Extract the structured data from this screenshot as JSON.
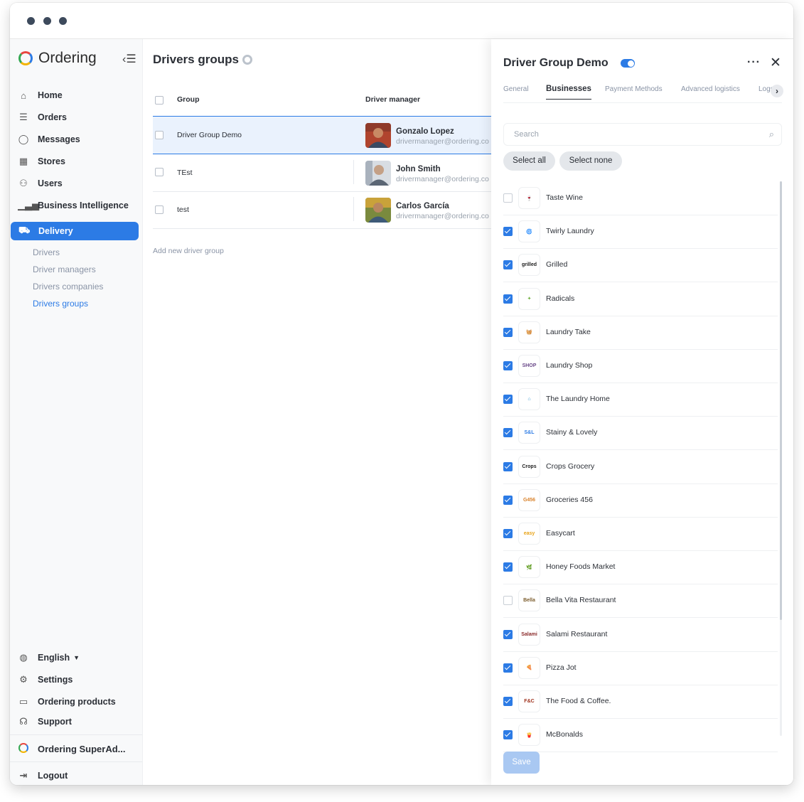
{
  "app": {
    "brand": "Ordering"
  },
  "sidebar": {
    "nav": [
      {
        "label": "Home",
        "icon": "home-icon"
      },
      {
        "label": "Orders",
        "icon": "list-icon"
      },
      {
        "label": "Messages",
        "icon": "chat-icon"
      },
      {
        "label": "Stores",
        "icon": "store-icon"
      },
      {
        "label": "Users",
        "icon": "users-icon"
      },
      {
        "label": "Business Intelligence",
        "icon": "chart-icon"
      },
      {
        "label": "Delivery",
        "icon": "truck-icon"
      }
    ],
    "delivery_sub": [
      "Drivers",
      "Driver managers",
      "Drivers companies",
      "Drivers groups"
    ],
    "bottom": {
      "language": "English",
      "settings": "Settings",
      "ordering_products": "Ordering products",
      "support": "Support",
      "account": "Ordering SuperAd...",
      "logout": "Logout"
    }
  },
  "main": {
    "title": "Drivers groups",
    "columns": {
      "group": "Group",
      "manager": "Driver manager"
    },
    "rows": [
      {
        "group": "Driver Group Demo",
        "manager": "Gonzalo Lopez",
        "email": "drivermanager@ordering.co"
      },
      {
        "group": "TEst",
        "manager": "John Smith",
        "email": "drivermanager@ordering.co"
      },
      {
        "group": "test",
        "manager": "Carlos García",
        "email": "drivermanager@ordering.co"
      }
    ],
    "add_link": "Add new driver group"
  },
  "panel": {
    "title": "Driver Group Demo",
    "tabs": [
      "General",
      "Businesses",
      "Payment Methods",
      "Advanced logistics",
      "Logs"
    ],
    "active_tab": "Businesses",
    "search_placeholder": "Search",
    "select_all": "Select all",
    "select_none": "Select none",
    "save": "Save",
    "businesses": [
      {
        "name": "Taste Wine",
        "checked": false,
        "logo": "🍷"
      },
      {
        "name": "Twirly Laundry",
        "checked": true,
        "logo": "🌀"
      },
      {
        "name": "Grilled",
        "checked": true,
        "logo": "grilled"
      },
      {
        "name": "Radicals",
        "checked": true,
        "logo": "✦"
      },
      {
        "name": "Laundry Take",
        "checked": true,
        "logo": "🧺"
      },
      {
        "name": "Laundry Shop",
        "checked": true,
        "logo": "SHOP"
      },
      {
        "name": "The Laundry Home",
        "checked": true,
        "logo": "⌂"
      },
      {
        "name": "Stainy & Lovely",
        "checked": true,
        "logo": "S&L"
      },
      {
        "name": "Crops Grocery",
        "checked": true,
        "logo": "Crops"
      },
      {
        "name": "Groceries 456",
        "checked": true,
        "logo": "G456"
      },
      {
        "name": "Easycart",
        "checked": true,
        "logo": "easy"
      },
      {
        "name": "Honey Foods Market",
        "checked": true,
        "logo": "🌿"
      },
      {
        "name": "Bella Vita Restaurant",
        "checked": false,
        "logo": "Bella"
      },
      {
        "name": "Salami Restaurant",
        "checked": true,
        "logo": "Salami"
      },
      {
        "name": "Pizza Jot",
        "checked": true,
        "logo": "🍕"
      },
      {
        "name": "The Food & Coffee.",
        "checked": true,
        "logo": "F&C"
      },
      {
        "name": "McBonalds",
        "checked": true,
        "logo": "🍟"
      }
    ]
  },
  "colors": {
    "accent": "#2c7be5",
    "sidebar_bg": "#f8f9fa"
  }
}
